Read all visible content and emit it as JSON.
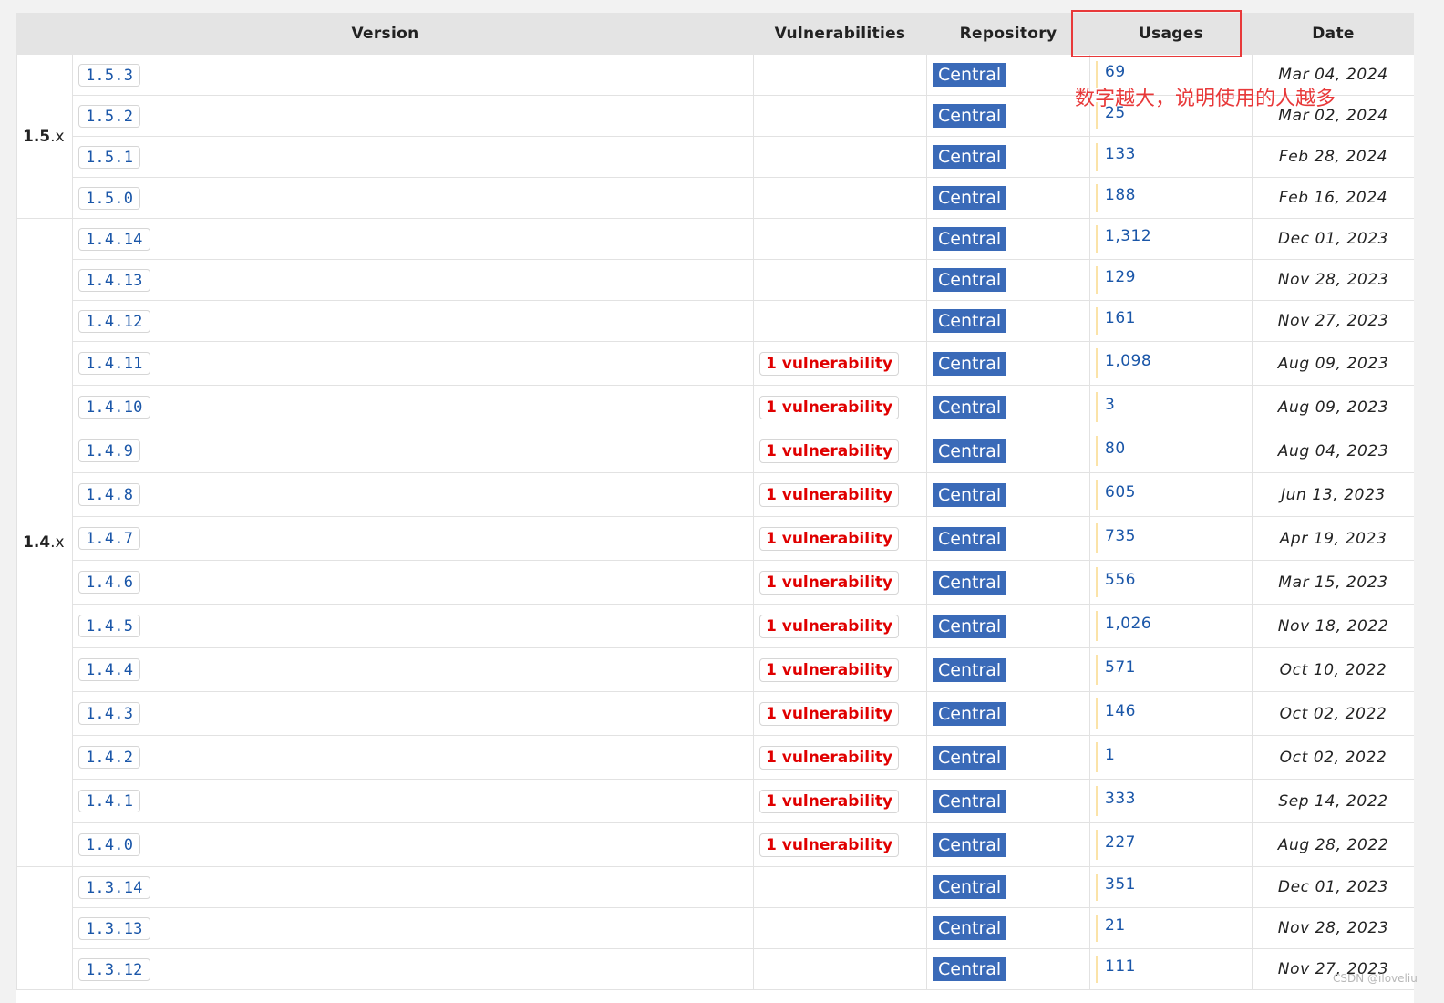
{
  "headers": {
    "version": "Version",
    "vulnerabilities": "Vulnerabilities",
    "repository": "Repository",
    "usages": "Usages",
    "date": "Date"
  },
  "groups": [
    {
      "major": "1.5",
      "suffix": ".x"
    },
    {
      "major": "1.4",
      "suffix": ".x"
    },
    {
      "major": "",
      "suffix": ""
    }
  ],
  "rows": [
    {
      "group": 0,
      "version": "1.5.3",
      "vuln": "",
      "repo": "Central",
      "usages": "69",
      "date": "Mar 04, 2024"
    },
    {
      "group": 0,
      "version": "1.5.2",
      "vuln": "",
      "repo": "Central",
      "usages": "25",
      "date": "Mar 02, 2024"
    },
    {
      "group": 0,
      "version": "1.5.1",
      "vuln": "",
      "repo": "Central",
      "usages": "133",
      "date": "Feb 28, 2024"
    },
    {
      "group": 0,
      "version": "1.5.0",
      "vuln": "",
      "repo": "Central",
      "usages": "188",
      "date": "Feb 16, 2024"
    },
    {
      "group": 1,
      "version": "1.4.14",
      "vuln": "",
      "repo": "Central",
      "usages": "1,312",
      "date": "Dec 01, 2023"
    },
    {
      "group": 1,
      "version": "1.4.13",
      "vuln": "",
      "repo": "Central",
      "usages": "129",
      "date": "Nov 28, 2023"
    },
    {
      "group": 1,
      "version": "1.4.12",
      "vuln": "",
      "repo": "Central",
      "usages": "161",
      "date": "Nov 27, 2023"
    },
    {
      "group": 1,
      "version": "1.4.11",
      "vuln": "1 vulnerability",
      "repo": "Central",
      "usages": "1,098",
      "date": "Aug 09, 2023"
    },
    {
      "group": 1,
      "version": "1.4.10",
      "vuln": "1 vulnerability",
      "repo": "Central",
      "usages": "3",
      "date": "Aug 09, 2023"
    },
    {
      "group": 1,
      "version": "1.4.9",
      "vuln": "1 vulnerability",
      "repo": "Central",
      "usages": "80",
      "date": "Aug 04, 2023"
    },
    {
      "group": 1,
      "version": "1.4.8",
      "vuln": "1 vulnerability",
      "repo": "Central",
      "usages": "605",
      "date": "Jun 13, 2023"
    },
    {
      "group": 1,
      "version": "1.4.7",
      "vuln": "1 vulnerability",
      "repo": "Central",
      "usages": "735",
      "date": "Apr 19, 2023"
    },
    {
      "group": 1,
      "version": "1.4.6",
      "vuln": "1 vulnerability",
      "repo": "Central",
      "usages": "556",
      "date": "Mar 15, 2023"
    },
    {
      "group": 1,
      "version": "1.4.5",
      "vuln": "1 vulnerability",
      "repo": "Central",
      "usages": "1,026",
      "date": "Nov 18, 2022"
    },
    {
      "group": 1,
      "version": "1.4.4",
      "vuln": "1 vulnerability",
      "repo": "Central",
      "usages": "571",
      "date": "Oct 10, 2022"
    },
    {
      "group": 1,
      "version": "1.4.3",
      "vuln": "1 vulnerability",
      "repo": "Central",
      "usages": "146",
      "date": "Oct 02, 2022"
    },
    {
      "group": 1,
      "version": "1.4.2",
      "vuln": "1 vulnerability",
      "repo": "Central",
      "usages": "1",
      "date": "Oct 02, 2022"
    },
    {
      "group": 1,
      "version": "1.4.1",
      "vuln": "1 vulnerability",
      "repo": "Central",
      "usages": "333",
      "date": "Sep 14, 2022"
    },
    {
      "group": 1,
      "version": "1.4.0",
      "vuln": "1 vulnerability",
      "repo": "Central",
      "usages": "227",
      "date": "Aug 28, 2022"
    },
    {
      "group": 2,
      "version": "1.3.14",
      "vuln": "",
      "repo": "Central",
      "usages": "351",
      "date": "Dec 01, 2023"
    },
    {
      "group": 2,
      "version": "1.3.13",
      "vuln": "",
      "repo": "Central",
      "usages": "21",
      "date": "Nov 28, 2023"
    },
    {
      "group": 2,
      "version": "1.3.12",
      "vuln": "",
      "repo": "Central",
      "usages": "111",
      "date": "Nov 27, 2023"
    }
  ],
  "annotation": {
    "text": "数字越大，说明使用的人越多",
    "color": "#e8393a"
  },
  "watermark": "CSDN @iloveliu",
  "colors": {
    "link": "#1a56a8",
    "repo_badge": "#3a6ab8",
    "vuln_text": "#e00000",
    "usage_bar": "#fbe3a8",
    "header_bg": "#e4e4e4"
  }
}
